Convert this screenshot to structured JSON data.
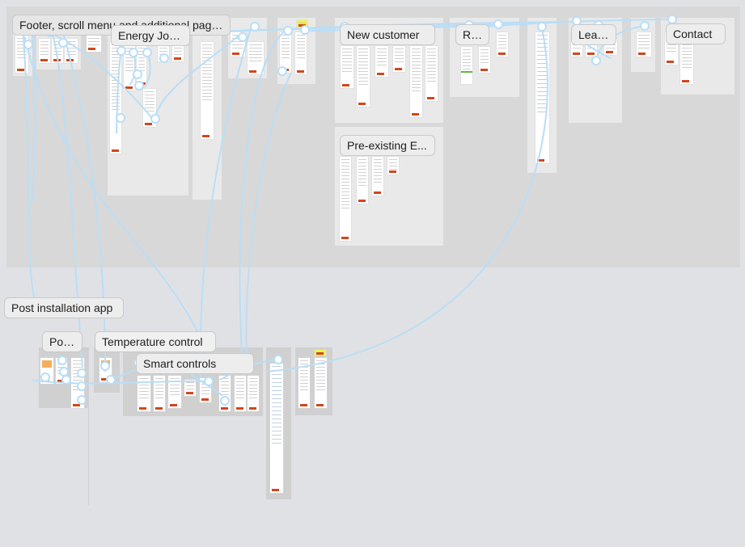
{
  "canvas": {
    "sections": [
      {
        "id": "sec-1",
        "title": "Footer, scroll menu and additional pages"
      },
      {
        "id": "sec-2",
        "title": "Energy Journey"
      },
      {
        "id": "sec-3",
        "title": "New customer"
      },
      {
        "id": "sec-4",
        "title": "RAF"
      },
      {
        "id": "sec-5",
        "title": "Leads"
      },
      {
        "id": "sec-6",
        "title": "Contact"
      },
      {
        "id": "sec-7",
        "title": "Pre-existing E..."
      },
      {
        "id": "sec-8",
        "title": "Post installation app"
      },
      {
        "id": "sec-9",
        "title": "Pos..."
      },
      {
        "id": "sec-10",
        "title": "Temperature control"
      },
      {
        "id": "sec-11",
        "title": "Smart controls"
      }
    ]
  },
  "colors": {
    "canvas_bg": "#e0e1e4",
    "section_bg": "#d8d8d8",
    "frame_bg": "#e9e9e9",
    "connector": "#b9def7",
    "accent": "#d2461d",
    "highlight": "#eef35a"
  }
}
